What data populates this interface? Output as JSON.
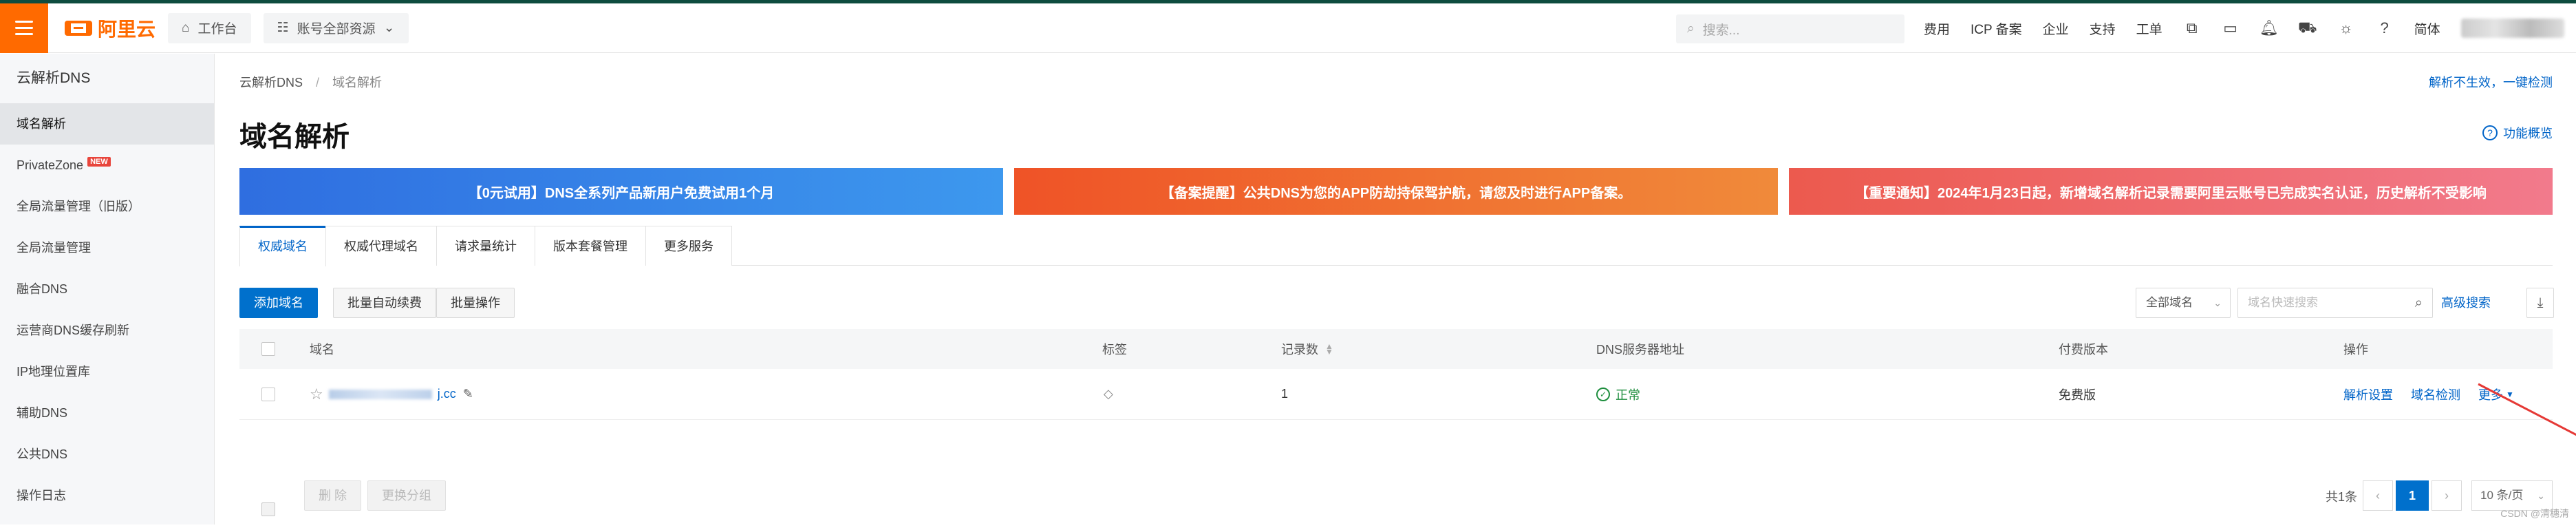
{
  "topbar": {
    "logo_text": "阿里云",
    "workbench": "工作台",
    "account_resources": "账号全部资源",
    "search_placeholder": "搜索...",
    "links": [
      "费用",
      "ICP 备案",
      "企业",
      "支持",
      "工单"
    ],
    "language": "简体",
    "brand_color": "#ff6a00"
  },
  "sidebar": {
    "title": "云解析DNS",
    "items": [
      {
        "label": "域名解析",
        "active": true
      },
      {
        "label": "PrivateZone",
        "badge": "NEW"
      },
      {
        "label": "全局流量管理（旧版）"
      },
      {
        "label": "全局流量管理"
      },
      {
        "label": "融合DNS"
      },
      {
        "label": "运营商DNS缓存刷新"
      },
      {
        "label": "IP地理位置库"
      },
      {
        "label": "辅助DNS"
      },
      {
        "label": "公共DNS"
      },
      {
        "label": "操作日志"
      }
    ]
  },
  "breadcrumb": {
    "root": "云解析DNS",
    "separator": "/",
    "current": "域名解析"
  },
  "header": {
    "title": "域名解析",
    "top_right_link": "解析不生效，一键检测",
    "help_link": "功能概览"
  },
  "banners": [
    "【0元试用】DNS全系列产品新用户免费试用1个月",
    "【备案提醒】公共DNS为您的APP防劫持保驾护航，请您及时进行APP备案。",
    "【重要通知】2024年1月23日起，新增域名解析记录需要阿里云账号已完成实名认证，历史解析不受影响"
  ],
  "tabs": [
    {
      "label": "权威域名",
      "active": true
    },
    {
      "label": "权威代理域名"
    },
    {
      "label": "请求量统计"
    },
    {
      "label": "版本套餐管理"
    },
    {
      "label": "更多服务"
    }
  ],
  "toolbar": {
    "add_domain": "添加域名",
    "batch_renew": "批量自动续费",
    "batch_ops": "批量操作",
    "domain_filter": "全部域名",
    "search_placeholder": "域名快速搜索",
    "advanced_search": "高级搜索"
  },
  "table": {
    "columns": [
      "域名",
      "标签",
      "记录数",
      "DNS服务器地址",
      "付费版本",
      "操作"
    ],
    "rows": [
      {
        "domain_suffix": "j.cc",
        "record_count": "1",
        "dns_status": "正常",
        "plan": "免费版",
        "actions": [
          "解析设置",
          "域名检测",
          "更多"
        ]
      }
    ]
  },
  "footer": {
    "delete": "删 除",
    "change_group": "更换分组",
    "total": "共1条",
    "current_page": "1",
    "page_size": "10 条/页"
  },
  "watermark": "CSDN @清穗清"
}
